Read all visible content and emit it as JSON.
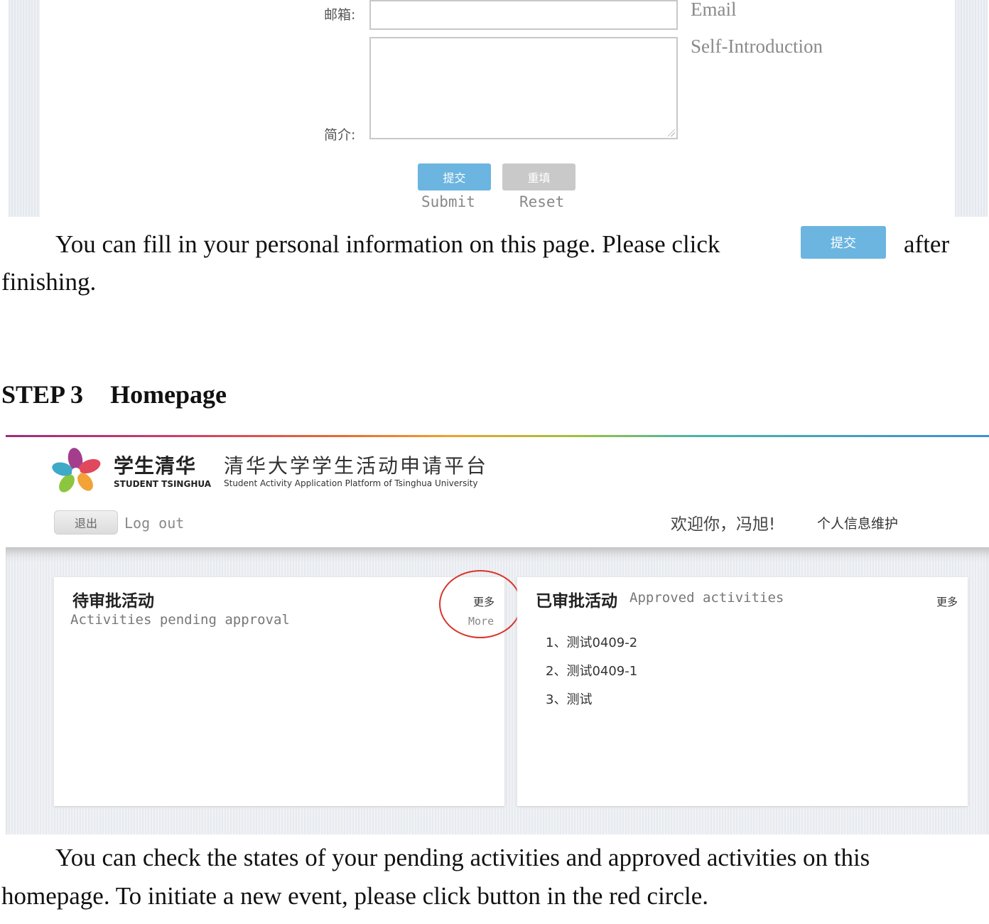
{
  "form": {
    "email_label": "邮箱:",
    "email_hint": "Email",
    "intro_label": "简介:",
    "intro_hint": "Self-Introduction",
    "submit_label": "提交",
    "submit_caption": "Submit",
    "reset_label": "重填",
    "reset_caption": "Reset"
  },
  "paragraph1": {
    "line1_before": "You can fill in your personal information on this page. Please click",
    "button_label": "提交",
    "line1_after": "after",
    "line2": "finishing."
  },
  "step3": {
    "step": "STEP 3",
    "title": "Homepage"
  },
  "homepage": {
    "brand_cn": "学生清华",
    "brand_en": "STUDENT TSINGHUA",
    "platform_cn": "清华大学学生活动申请平台",
    "platform_en": "Student Activity Application Platform of Tsinghua University",
    "logout_label": "退出",
    "logout_caption": "Log out",
    "welcome": "欢迎你，冯旭!",
    "profile_link": "个人信息维护",
    "pending": {
      "title": "待审批活动",
      "subtitle": "Activities pending approval",
      "more_cn": "更多",
      "more_en": "More"
    },
    "approved": {
      "title": "已审批活动",
      "subtitle": "Approved activities",
      "more_cn": "更多",
      "items": [
        "1、测试0409-2",
        "2、测试0409-1",
        "3、测试"
      ]
    }
  },
  "paragraph2": {
    "line1": "You can check the states of your pending activities and approved activities on this",
    "line2": "homepage. To initiate a new event, please click button in the red circle."
  }
}
